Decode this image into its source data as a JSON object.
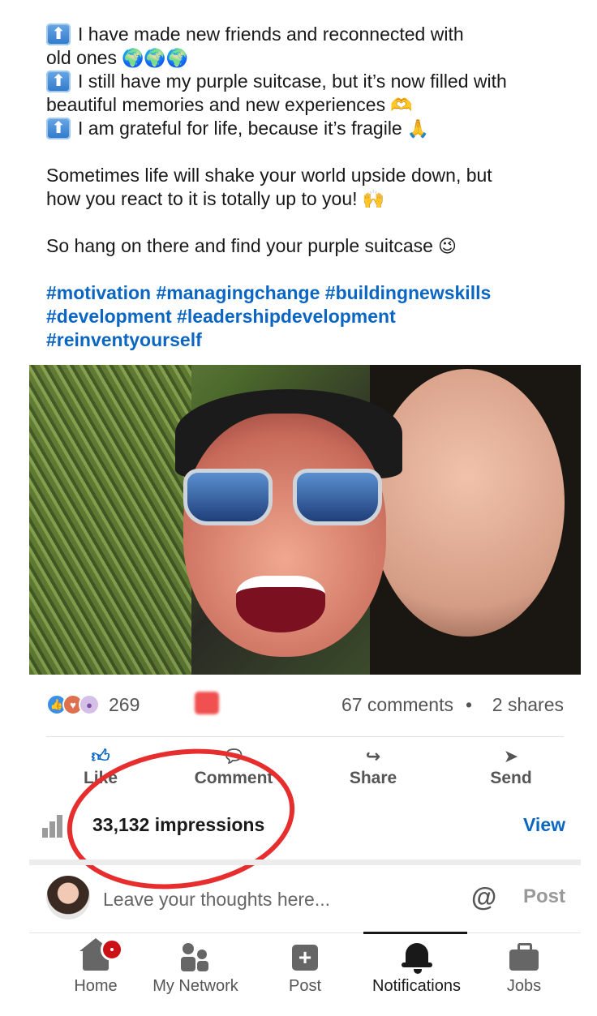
{
  "post": {
    "lines": [
      {
        "text": "I have made new friends and reconnected with",
        "bullet": true
      },
      {
        "text": "old ones",
        "emoji": "🌍🌍🌍"
      },
      {
        "text": "I still have my purple suitcase, but it’s now filled with",
        "bullet": true
      },
      {
        "text": "beautiful memories and new experiences",
        "emoji": "🫶"
      },
      {
        "text": "I am grateful for life, because it’s fragile",
        "bullet": true,
        "emoji": "🙏"
      }
    ],
    "para2_line1": "Sometimes life will shake your world upside down, but",
    "para2_line2": "how you react to it is totally up to you!",
    "para2_emoji": "🙌",
    "para3": "So hang on there and find your purple suitcase",
    "para3_emoji": "😉",
    "hashtags_line1": "#motivation #managingchange #buildingnewskills",
    "hashtags_line2": "#development #leadershipdevelopment",
    "hashtags_line3": "#reinventyourself",
    "bullet_glyph": "⬆"
  },
  "social": {
    "reaction_count": "269",
    "comments": "67 comments",
    "separator": "•",
    "shares": "2 shares"
  },
  "actions": {
    "like": "Like",
    "comment": "Comment",
    "share": "Share",
    "send": "Send"
  },
  "impressions": {
    "text": "33,132 impressions",
    "view": "View"
  },
  "comment_box": {
    "placeholder": "Leave your thoughts here...",
    "at_symbol": "@",
    "post": "Post"
  },
  "tabs": {
    "home": "Home",
    "network": "My Network",
    "post": "Post",
    "notifications": "Notifications",
    "jobs": "Jobs"
  },
  "colors": {
    "accent": "#0a66c2",
    "annotation_red": "#e62e2e",
    "badge_red": "#cc1016"
  }
}
